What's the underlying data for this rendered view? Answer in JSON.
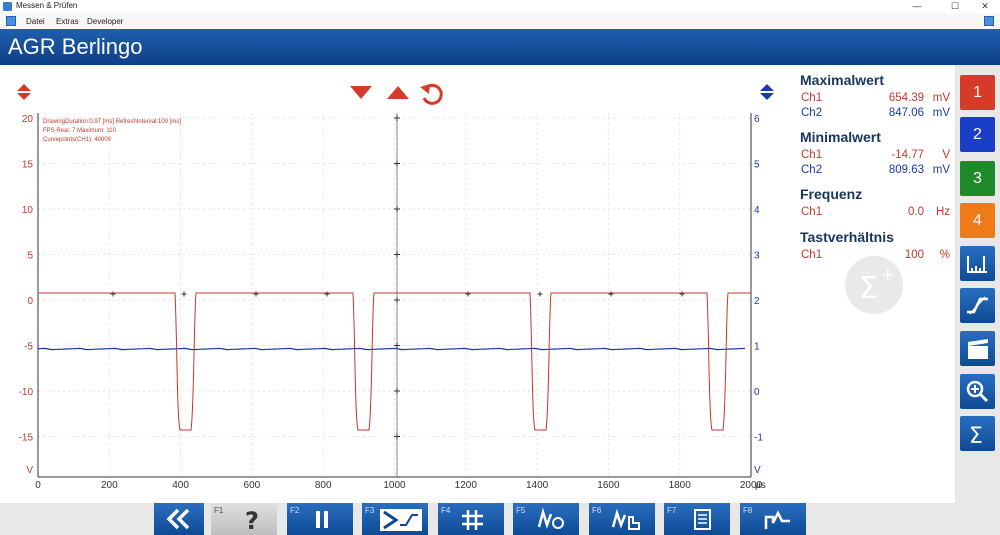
{
  "window": {
    "title": "Messen & Prüfen",
    "minimize": "—",
    "maximize": "☐",
    "close": "✕"
  },
  "menu": {
    "items": [
      "Datei",
      "Extras",
      "Developer"
    ]
  },
  "header": {
    "title": "AGR Berlingo"
  },
  "plot": {
    "left_axis_ticks": [
      "20",
      "15",
      "10",
      "5",
      "0",
      "-5",
      "-10",
      "-15",
      "V"
    ],
    "right_axis_ticks": [
      "6",
      "5",
      "4",
      "3",
      "2",
      "1",
      "0",
      "-1",
      "V"
    ],
    "x_axis_ticks": [
      "0",
      "200",
      "400",
      "600",
      "800",
      "1000",
      "1200",
      "1400",
      "1600",
      "1800",
      "2000"
    ],
    "x_unit": "μs",
    "debug_lines": [
      "DrawingDuration:0.97 [ms]  RefreshInterval:100 [ms]",
      "FPS Real: 7  Maximum: 110",
      "Curvepoints(CH1): 40000"
    ],
    "colors": {
      "ch1": "#c0392b",
      "ch2": "#1a3aa8",
      "grid": "#d9d9d9"
    }
  },
  "measurements": [
    {
      "title": "Maximalwert",
      "rows": [
        {
          "ch": "Ch1",
          "value": "654.39",
          "unit": "mV",
          "color": "red"
        },
        {
          "ch": "Ch2",
          "value": "847.06",
          "unit": "mV",
          "color": "blue"
        }
      ]
    },
    {
      "title": "Minimalwert",
      "rows": [
        {
          "ch": "Ch1",
          "value": "-14.77",
          "unit": "V",
          "color": "red"
        },
        {
          "ch": "Ch2",
          "value": "809.63",
          "unit": "mV",
          "color": "blue"
        }
      ]
    },
    {
      "title": "Frequenz",
      "rows": [
        {
          "ch": "Ch1",
          "value": "0.0",
          "unit": "Hz",
          "color": "red"
        }
      ]
    },
    {
      "title": "Tastverhältnis",
      "rows": [
        {
          "ch": "Ch1",
          "value": "100",
          "unit": "%",
          "color": "red"
        }
      ]
    }
  ],
  "sidebar": {
    "channels": [
      {
        "label": "1",
        "color": "#d63b2a"
      },
      {
        "label": "2",
        "color": "#1a3ec8"
      },
      {
        "label": "3",
        "color": "#1f8a2a"
      },
      {
        "label": "4",
        "color": "#f07a17"
      }
    ],
    "tools": [
      "cursor-measure-icon",
      "trigger-icon",
      "clapper-icon",
      "zoom-in-icon",
      "sigma-icon"
    ]
  },
  "function_keys": [
    {
      "key": "",
      "icon": "double-chevron-left-icon"
    },
    {
      "key": "F1",
      "icon": "help-icon"
    },
    {
      "key": "F2",
      "icon": "pause-icon"
    },
    {
      "key": "F3",
      "icon": "trigger-compare-icon"
    },
    {
      "key": "F4",
      "icon": "grid-hash-icon"
    },
    {
      "key": "F5",
      "icon": "probe-settings-icon"
    },
    {
      "key": "F6",
      "icon": "hand-wave-icon"
    },
    {
      "key": "F7",
      "icon": "document-icon"
    },
    {
      "key": "F8",
      "icon": "signal-step-icon"
    }
  ]
}
